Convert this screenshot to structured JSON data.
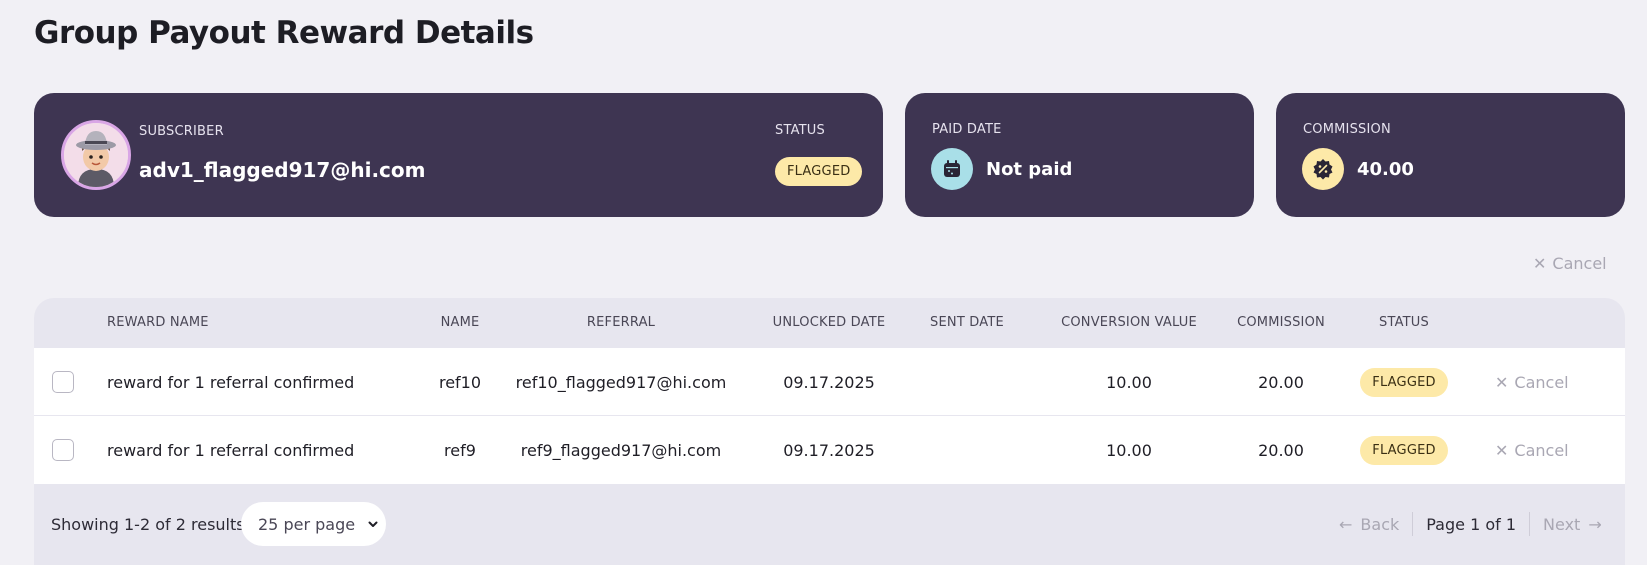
{
  "page": {
    "title": "Group Payout Reward Details"
  },
  "subscriber_card": {
    "label": "SUBSCRIBER",
    "email": "adv1_flagged917@hi.com",
    "status_label": "STATUS",
    "status": "FLAGGED"
  },
  "paid_card": {
    "label": "PAID DATE",
    "value": "Not paid"
  },
  "commission_card": {
    "label": "COMMISSION",
    "value": "40.00"
  },
  "actions": {
    "cancel_all": "Cancel"
  },
  "table": {
    "headers": {
      "reward_name": "REWARD NAME",
      "name": "NAME",
      "referral": "REFERRAL",
      "unlocked_date": "UNLOCKED DATE",
      "sent_date": "SENT DATE",
      "conversion_value": "CONVERSION VALUE",
      "commission": "COMMISSION",
      "status": "STATUS"
    },
    "rows": [
      {
        "reward_name": "reward for 1 referral confirmed",
        "name": "ref10",
        "referral": "ref10_flagged917@hi.com",
        "unlocked_date": "09.17.2025",
        "sent_date": "",
        "conversion_value": "10.00",
        "commission": "20.00",
        "status": "FLAGGED",
        "action": "Cancel"
      },
      {
        "reward_name": "reward for 1 referral confirmed",
        "name": "ref9",
        "referral": "ref9_flagged917@hi.com",
        "unlocked_date": "09.17.2025",
        "sent_date": "",
        "conversion_value": "10.00",
        "commission": "20.00",
        "status": "FLAGGED",
        "action": "Cancel"
      }
    ]
  },
  "footer": {
    "results_text": "Showing 1-2 of 2 results",
    "per_page": "25 per page",
    "back": "Back",
    "page_info": "Page 1 of 1",
    "next": "Next"
  },
  "colors": {
    "card_bg": "#3e3552",
    "badge_bg": "#fde9a8",
    "paid_icon_bg": "#a9dfe8",
    "commission_icon_bg": "#fde9a8",
    "page_bg": "#f1f0f5"
  },
  "icons": {
    "avatar": "avatar-image",
    "paid": "calendar-icon",
    "commission": "discount-badge-icon",
    "cancel": "close-icon",
    "dropdown": "chevron-down-icon",
    "back": "arrow-left-icon",
    "next": "arrow-right-icon"
  }
}
